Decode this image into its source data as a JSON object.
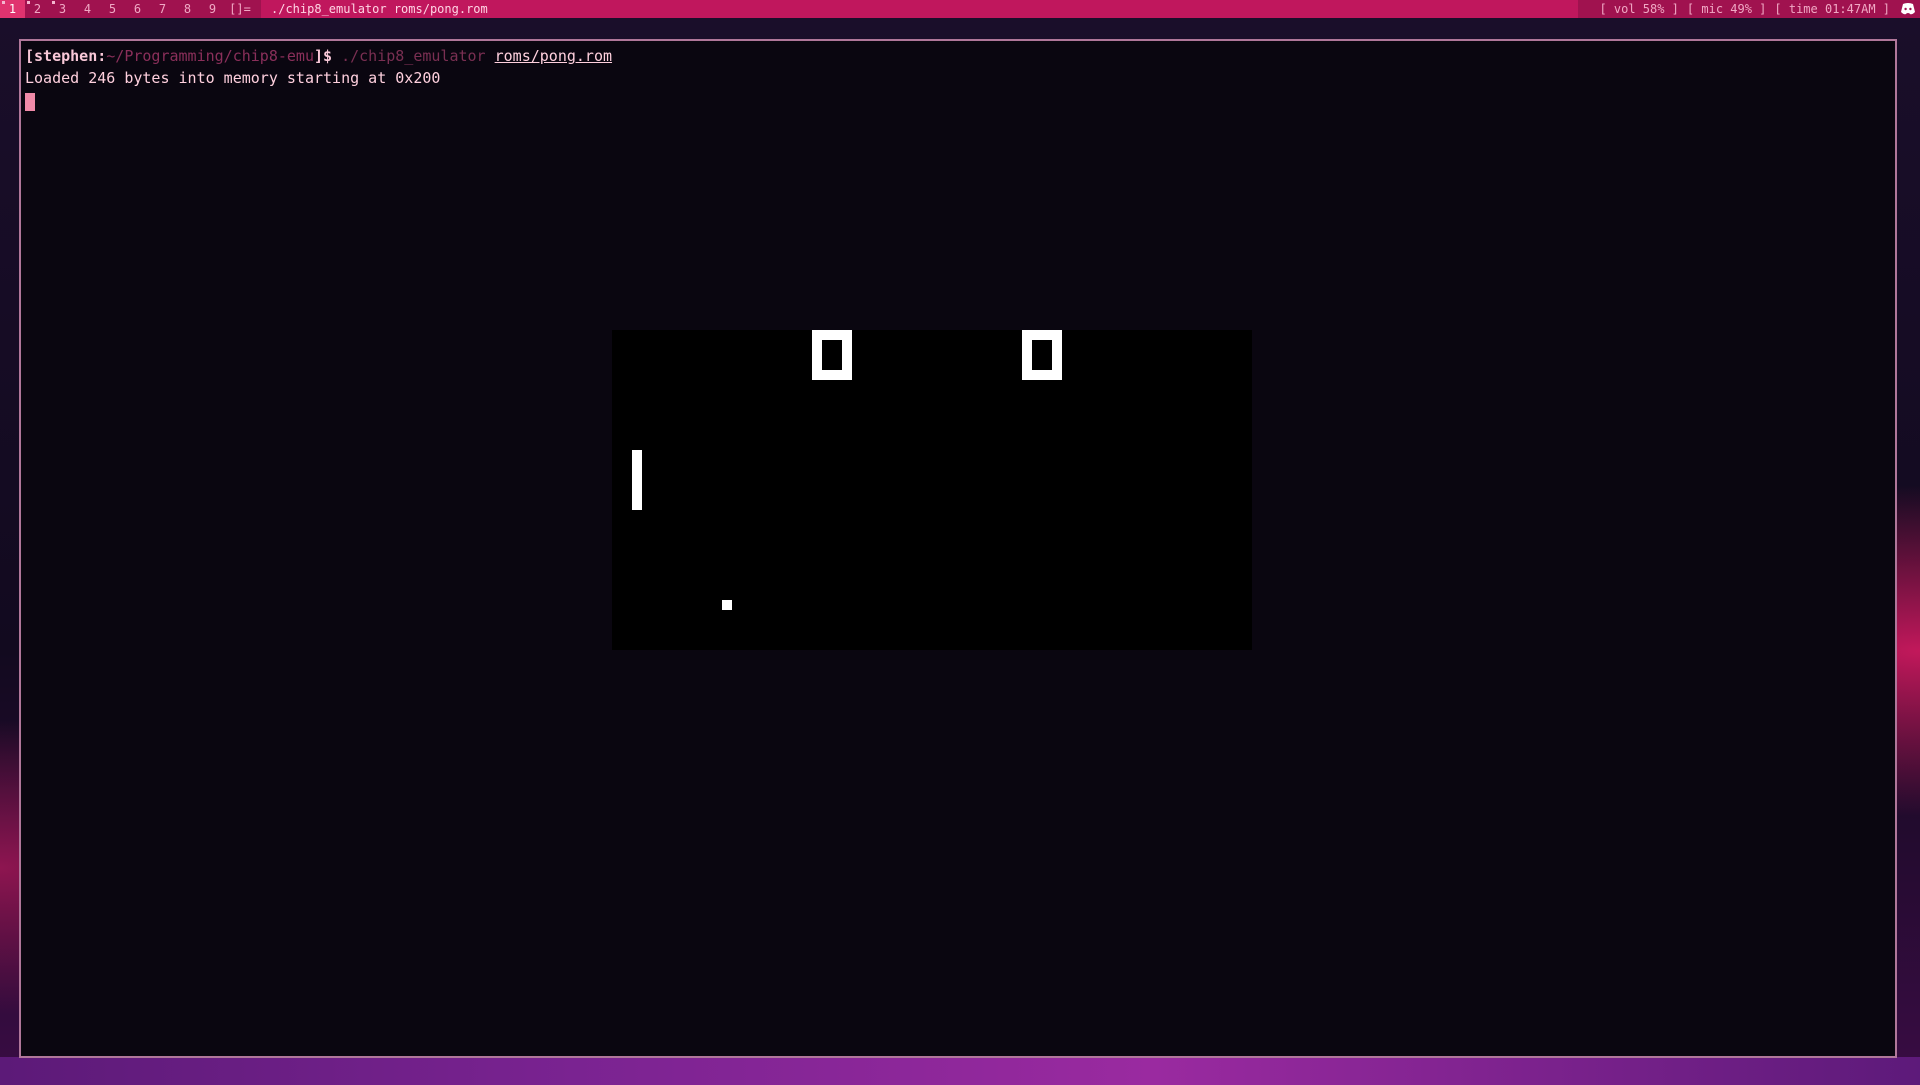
{
  "topbar": {
    "workspaces": [
      "1",
      "2",
      "3",
      "4",
      "5",
      "6",
      "7",
      "8",
      "9"
    ],
    "active_workspace": "1",
    "layout_symbol": "[]=",
    "window_title": "./chip8_emulator roms/pong.rom",
    "status": {
      "vol": "[ vol 58% ]",
      "mic": "[ mic 49% ]",
      "time": "[ time 01:47AM ]"
    }
  },
  "terminal": {
    "prompt_open": "[",
    "prompt_user": "stephen:",
    "prompt_path": "~/Programming/chip8-emu",
    "prompt_close": "]$",
    "command": "./chip8_emulator",
    "argument": "roms/pong.rom",
    "output_line": "Loaded 246 bytes into memory starting at 0x200"
  },
  "emulator": {
    "score_left": "0",
    "score_right": "0"
  },
  "colors": {
    "bar_bg": "#a0124f",
    "title_bg": "#c0175d",
    "terminal_border": "#b0779a",
    "cursor": "#f08aa8"
  }
}
